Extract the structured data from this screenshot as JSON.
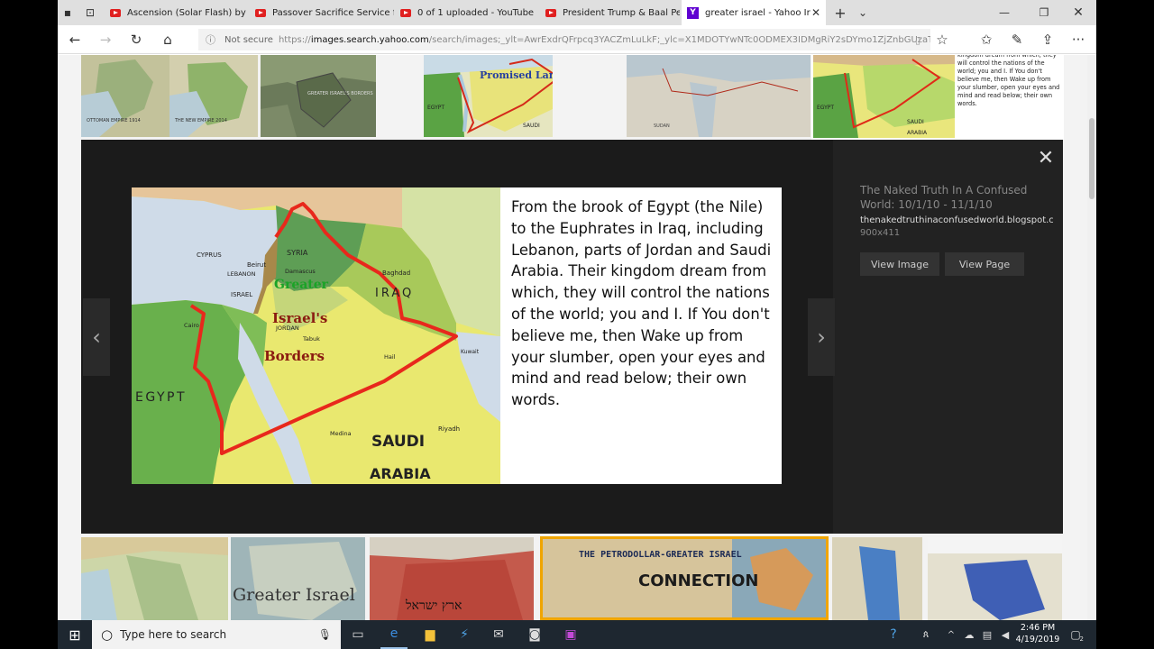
{
  "tabs": [
    {
      "title": "Ascension (Solar Flash) by C",
      "icon": "youtube-icon"
    },
    {
      "title": "Passover Sacrifice Service fc",
      "icon": "youtube-icon"
    },
    {
      "title": "0 of 1 uploaded - YouTube",
      "icon": "youtube-icon"
    },
    {
      "title": "President Trump & Baal Pe",
      "icon": "youtube-icon"
    },
    {
      "title": "greater israel - Yahoo Ir",
      "icon": "yahoo-icon",
      "active": true
    }
  ],
  "window_controls": {
    "new_tab": "+",
    "tab_menu": "⌄",
    "minimize": "—",
    "restore": "❐",
    "close": "✕"
  },
  "address": {
    "security": "Not secure",
    "url_protocol": "https://",
    "url_host": "images.search.yahoo.com",
    "url_rest": "/search/images;_ylt=AwrExdrQFrpcq3YACZmLuLkF;_ylc=X1MDOTYwNTc0ODMEX3IDMgRiY2sDYmo1ZjZnbGUzaTZudCU"
  },
  "top_thumbs": {
    "t1_left": "OTTOMAN EMPIRE 1914",
    "t1_right": "THE NEW EMPIRE 2014",
    "t2": "GREATER ISRAEL'S BORDERS",
    "t3": "Promised Land",
    "t3_egypt": "EGYPT",
    "t3_saudi": "SAUDI",
    "t4_sudan": "SUDAN",
    "t5_text": "kingdom dream from which, they will control the nations of the world; you and I. If You don't believe me, then Wake up from your slumber, open your eyes and mind and read below; their own words.",
    "t5_egypt": "EGYPT",
    "t5_saudi": "SAUDI",
    "t5_arabia": "ARABIA"
  },
  "viewer": {
    "close": "✕",
    "prev": "‹",
    "next": "›",
    "caption": "From the brook of Egypt (the Nile) to the Euphrates in Iraq, including Lebanon, parts of Jordan and Saudi Arabia. Their kingdom dream from which, they will control the nations of the world; you and I. If You don't believe me, then Wake up from your slumber, open your eyes and mind and read below; their own words.",
    "map_labels": {
      "cyprus": "CYPRUS",
      "beirut": "Beirut",
      "lebanon": "LEBANON",
      "syria": "SYRIA",
      "damascus": "Damascus",
      "israel": "ISRAEL",
      "jordan": "JORDAN",
      "greater": "Greater",
      "israels": "Israel's",
      "borders": "Borders",
      "iraq": "IRAQ",
      "baghdad": "Baghdad",
      "egypt": "EGYPT",
      "saudi": "SAUDI",
      "arabia": "ARABIA",
      "kuwait": "Kuwait",
      "riyadh": "Riyadh",
      "medina": "Medina",
      "tabuk": "Tabuk",
      "cairo": "Cairo",
      "hail": "Hail"
    },
    "source_title": "The Naked Truth In A Confused World: 10/1/10 - 11/1/10",
    "source_domain": "thenakedtruthinaconfusedworld.blogspot.c...",
    "dimensions": "900x411",
    "view_image": "View Image",
    "view_page": "View Page"
  },
  "bottom_thumbs": {
    "b2": "Greater Israel",
    "b3": "ארץ ישראל",
    "b4_line1": "THE PETRODOLLAR-GREATER ISRAEL",
    "b4_line2": "CONNECTION"
  },
  "taskbar": {
    "search_placeholder": "Type here to search",
    "time": "2:46 PM",
    "date": "4/19/2019",
    "notification_count": "2"
  },
  "colors": {
    "border_line": "#e8281c",
    "overlay_bg": "#1b1b1b",
    "taskbar_bg": "#1e2730"
  }
}
